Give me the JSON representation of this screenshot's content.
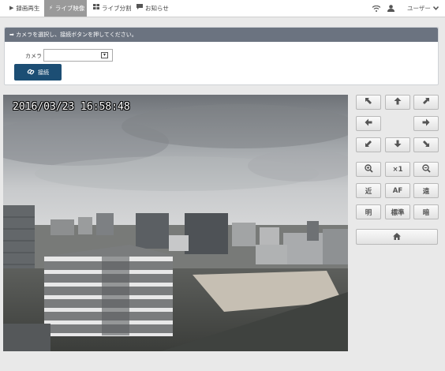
{
  "nav": {
    "tabs": [
      {
        "label": "録画再生",
        "icon": "play-icon"
      },
      {
        "label": "ライブ映像",
        "icon": "bolt-icon"
      },
      {
        "label": "ライブ分割",
        "icon": "grid-icon"
      },
      {
        "label": "お知らせ",
        "icon": "message-icon"
      }
    ],
    "user_label": "ユーザー"
  },
  "panel": {
    "instruction": "カメラを選択し、接続ボタンを押してください。",
    "camera_label": "カメラ",
    "camera_value": "",
    "connect_label": "接続"
  },
  "camera": {
    "timestamp": "2016/03/23  16:58:48"
  },
  "controls": {
    "zoom_reset": "×1",
    "focus_near": "近",
    "focus_auto": "AF",
    "focus_far": "遠",
    "bright": "明",
    "standard": "標準",
    "dark": "暗"
  },
  "colors": {
    "panel_header": "#6b7380",
    "connect_button": "#1c4e74",
    "active_tab": "#9a9a9a"
  }
}
